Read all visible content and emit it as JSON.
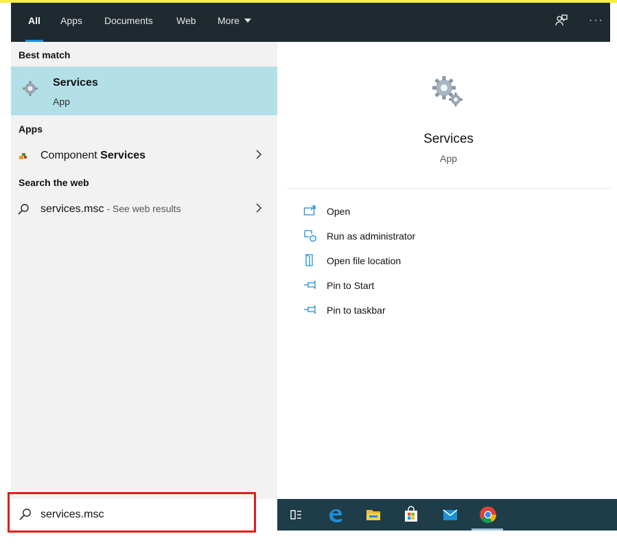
{
  "tabs": [
    {
      "label": "All",
      "active": true
    },
    {
      "label": "Apps",
      "active": false
    },
    {
      "label": "Documents",
      "active": false
    },
    {
      "label": "Web",
      "active": false
    },
    {
      "label": "More",
      "active": false
    }
  ],
  "top_actions": {
    "feedback_icon": "feedback-icon",
    "more_icon": "ellipsis-icon",
    "more_glyph": "···"
  },
  "left": {
    "best_match_heading": "Best match",
    "best_match": {
      "title": "Services",
      "subtitle": "App",
      "icon": "services-gear-icon"
    },
    "apps_heading": "Apps",
    "apps": [
      {
        "prefix": "Component ",
        "bold": "Services",
        "icon": "component-services-icon"
      }
    ],
    "web_heading": "Search the web",
    "web": [
      {
        "query": "services.msc",
        "suffix": " - See web results",
        "icon": "search-icon"
      }
    ]
  },
  "search": {
    "value": "services.msc",
    "placeholder": ""
  },
  "preview": {
    "title": "Services",
    "subtitle": "App",
    "actions": [
      {
        "label": "Open",
        "icon": "open-icon"
      },
      {
        "label": "Run as administrator",
        "icon": "run-as-admin-icon"
      },
      {
        "label": "Open file location",
        "icon": "file-location-icon"
      },
      {
        "label": "Pin to Start",
        "icon": "pin-icon"
      },
      {
        "label": "Pin to taskbar",
        "icon": "pin-icon"
      }
    ]
  },
  "taskbar": {
    "items": [
      "task-view-icon",
      "edge-icon",
      "file-explorer-icon",
      "store-icon",
      "mail-icon",
      "chrome-icon"
    ],
    "active": "chrome-icon"
  },
  "colors": {
    "tabbar_bg": "#1f2a30",
    "accent": "#1c8fd8",
    "best_match_bg": "#b3e0e8",
    "left_bg": "#f2f2f2",
    "taskbar_bg": "#1f3d48",
    "highlight_outline": "#e41b17"
  }
}
